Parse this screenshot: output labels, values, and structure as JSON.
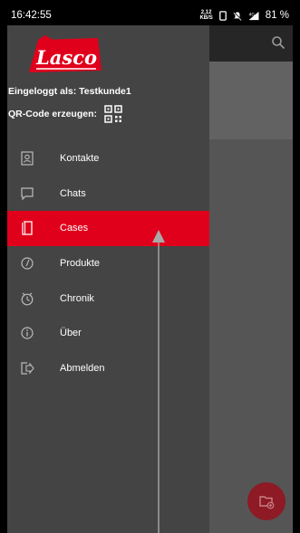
{
  "status_bar": {
    "time": "16:42:55",
    "speed_value": "2,12",
    "speed_unit": "KB/S",
    "signal_label": "4G",
    "battery": "81 %"
  },
  "drawer": {
    "logo_text": "Lasco",
    "logged_in_label": "Eingeloggt als: Testkunde1",
    "qr_label": "QR-Code erzeugen:",
    "items": [
      {
        "label": "Kontakte",
        "icon": "contacts-icon"
      },
      {
        "label": "Chats",
        "icon": "chat-icon"
      },
      {
        "label": "Cases",
        "icon": "cases-icon",
        "active": true
      },
      {
        "label": "Produkte",
        "icon": "products-icon"
      },
      {
        "label": "Chronik",
        "icon": "history-icon"
      },
      {
        "label": "Über",
        "icon": "info-icon"
      },
      {
        "label": "Abmelden",
        "icon": "logout-icon"
      }
    ]
  },
  "colors": {
    "accent": "#e0001b",
    "drawer_bg": "#444444",
    "fab": "#8d1a24"
  }
}
